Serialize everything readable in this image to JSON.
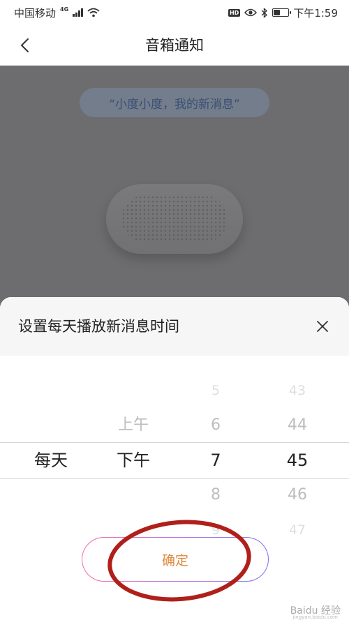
{
  "status_bar": {
    "carrier": "中国移动",
    "network": "4G",
    "hd": "HD",
    "time": "下午1:59",
    "battery_level": 0.45
  },
  "header": {
    "title": "音箱通知"
  },
  "content": {
    "voice_prompt": "“小度小度，我的新消息”"
  },
  "sheet": {
    "title": "设置每天播放新消息时间",
    "picker": {
      "frequency": [
        "每天"
      ],
      "period": [
        "上午",
        "下午"
      ],
      "hours": [
        "5",
        "6",
        "7",
        "8",
        "9"
      ],
      "minutes": [
        "43",
        "44",
        "45",
        "46",
        "47"
      ],
      "selected": {
        "frequency": "每天",
        "period": "下午",
        "hour": "7",
        "minute": "45"
      }
    },
    "confirm_label": "确定"
  },
  "watermark": {
    "text": "Baidu 经验",
    "subtext": "jingyan.baidu.com"
  }
}
